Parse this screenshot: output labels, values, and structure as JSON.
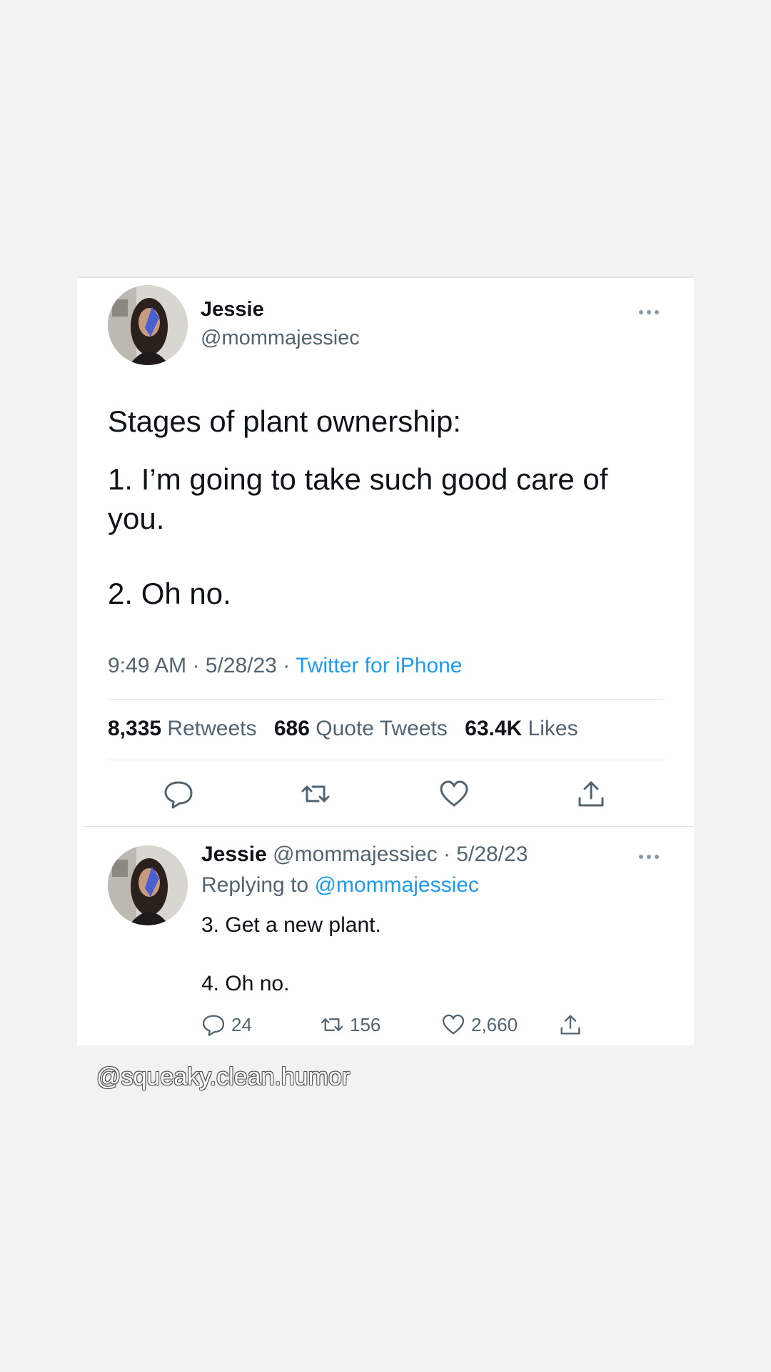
{
  "tweet": {
    "author_name": "Jessie",
    "author_handle": "@mommajessiec",
    "text_lines": [
      "Stages of plant ownership:",
      "1. I’m going to take such good care of you.",
      "2. Oh no."
    ],
    "time": "9:49 AM",
    "date": "5/28/23",
    "source": "Twitter for iPhone",
    "separator": "·",
    "stats": {
      "retweets_count": "8,335",
      "retweets_label": "Retweets",
      "quotes_count": "686",
      "quotes_label": "Quote Tweets",
      "likes_count": "63.4K",
      "likes_label": "Likes"
    }
  },
  "reply": {
    "author_name": "Jessie",
    "author_handle": "@mommajessiec",
    "date": "5/28/23",
    "replying_prefix": "Replying to",
    "replying_handle": "@mommajessiec",
    "text_line1": "3. Get a new plant.",
    "text_line2": "4. Oh no.",
    "replies": "24",
    "retweets": "156",
    "likes": "2,660"
  },
  "watermark": "@squeaky.clean.humor",
  "colors": {
    "background": "#f2f2f2",
    "card": "#ffffff",
    "primary_text": "#0f1419",
    "secondary_text": "#536471",
    "link": "#1d9bf0"
  },
  "icons": [
    "more-icon",
    "reply-icon",
    "retweet-icon",
    "like-icon",
    "share-icon",
    "avatar"
  ]
}
